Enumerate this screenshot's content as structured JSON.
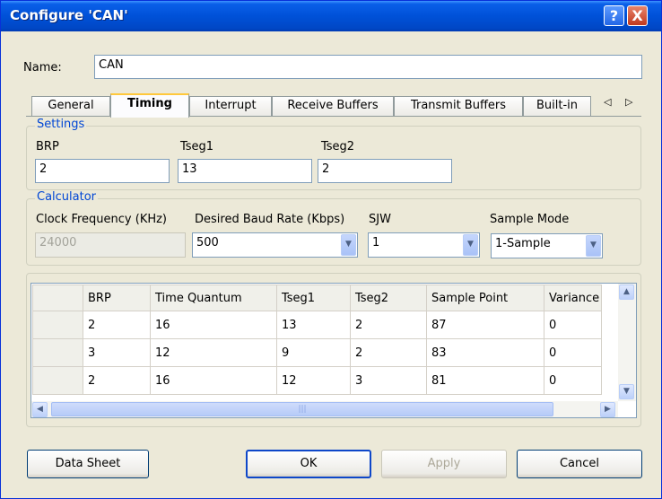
{
  "window": {
    "title": "Configure 'CAN'",
    "help_glyph": "?",
    "close_glyph": "X"
  },
  "name_label": "Name:",
  "name_value": "CAN",
  "tabs": [
    {
      "label": "General"
    },
    {
      "label": "Timing"
    },
    {
      "label": "Interrupt"
    },
    {
      "label": "Receive Buffers"
    },
    {
      "label": "Transmit Buffers"
    },
    {
      "label": "Built-in"
    }
  ],
  "tab_scroll": "◁ ▷",
  "settings": {
    "legend": "Settings",
    "brp_label": "BRP",
    "brp_value": "2",
    "tseg1_label": "Tseg1",
    "tseg1_value": "13",
    "tseg2_label": "Tseg2",
    "tseg2_value": "2"
  },
  "calculator": {
    "legend": "Calculator",
    "clock_label": "Clock Frequency (KHz)",
    "clock_value": "24000",
    "baud_label": "Desired Baud Rate (Kbps)",
    "baud_value": "500",
    "sjw_label": "SJW",
    "sjw_value": "1",
    "sample_label": "Sample Mode",
    "sample_value": "1-Sample"
  },
  "table": {
    "columns": [
      "BRP",
      "Time Quantum",
      "Tseg1",
      "Tseg2",
      "Sample Point",
      "Variance"
    ],
    "rows": [
      [
        "2",
        "16",
        "13",
        "2",
        "87",
        "0"
      ],
      [
        "3",
        "12",
        "9",
        "2",
        "83",
        "0"
      ],
      [
        "2",
        "16",
        "12",
        "3",
        "81",
        "0"
      ]
    ]
  },
  "buttons": {
    "datasheet": "Data Sheet",
    "ok": "OK",
    "apply": "Apply",
    "cancel": "Cancel"
  }
}
